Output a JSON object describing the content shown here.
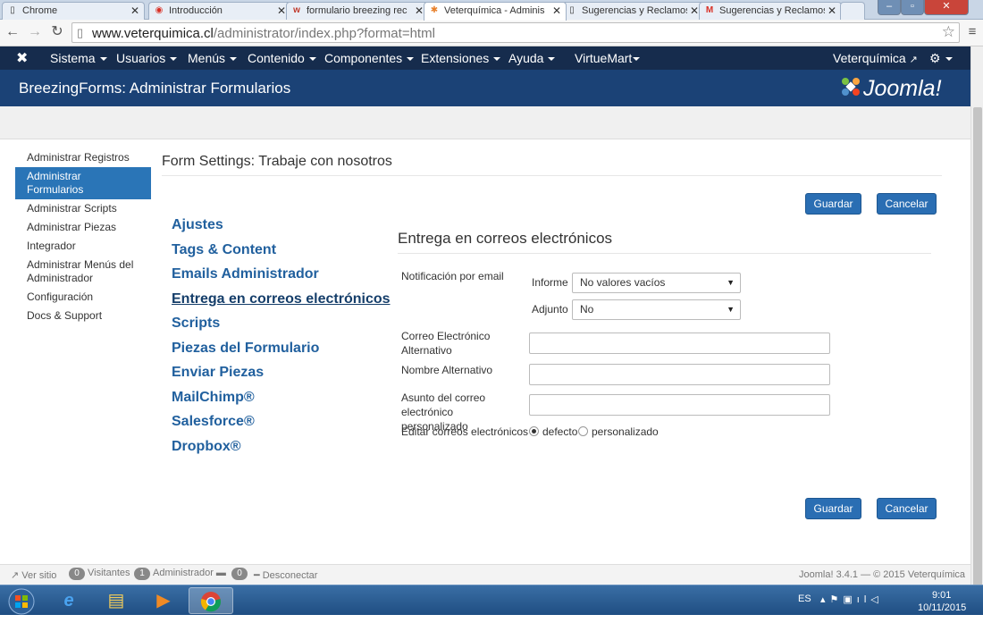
{
  "browser": {
    "tabs": [
      {
        "label": "Chrome",
        "icon": "page-icon",
        "active": false
      },
      {
        "label": "Introducción",
        "icon": "chrome-icon",
        "active": false
      },
      {
        "label": "formulario breezing rec",
        "icon": "w-icon",
        "active": false
      },
      {
        "label": "Veterquímica - Adminis",
        "icon": "joomla-icon",
        "active": true
      },
      {
        "label": "Sugerencias y Reclamos",
        "icon": "page-icon",
        "active": false
      },
      {
        "label": "Sugerencias y Reclamos",
        "icon": "gmail-icon",
        "active": false
      }
    ],
    "url_host": "www.veterquimica.cl",
    "url_path": "/administrator/index.php?format=html"
  },
  "joomla_nav": {
    "items": [
      {
        "label": "Sistema",
        "has_caret": true
      },
      {
        "label": "Usuarios",
        "has_caret": true
      },
      {
        "label": "Menús",
        "has_caret": true
      },
      {
        "label": "Contenido",
        "has_caret": true
      },
      {
        "label": "Componentes",
        "has_caret": true
      },
      {
        "label": "Extensiones",
        "has_caret": true
      },
      {
        "label": "Ayuda",
        "has_caret": true
      },
      {
        "label": "VirtueMart",
        "has_caret": true
      }
    ],
    "site_link": "Veterquímica"
  },
  "header": {
    "title": "BreezingForms: Administrar Formularios",
    "brand": "Joomla!"
  },
  "sidebar": {
    "items": [
      {
        "label": "Administrar Registros",
        "active": false
      },
      {
        "label": "Administrar Formularios",
        "active": true
      },
      {
        "label": "Administrar Scripts",
        "active": false
      },
      {
        "label": "Administrar Piezas",
        "active": false
      },
      {
        "label": "Integrador",
        "active": false
      },
      {
        "label": "Administrar Menús del Administrador",
        "active": false
      },
      {
        "label": "Configuración",
        "active": false
      },
      {
        "label": "Docs & Support",
        "active": false
      }
    ]
  },
  "main": {
    "form_title": "Form Settings: Trabaje con nosotros",
    "save_label": "Guardar",
    "cancel_label": "Cancelar",
    "settings_nav": [
      {
        "label": "Ajustes",
        "active": false
      },
      {
        "label": "Tags & Content",
        "active": false
      },
      {
        "label": "Emails Administrador",
        "active": false
      },
      {
        "label": "Entrega en correos electrónicos",
        "active": true
      },
      {
        "label": "Scripts",
        "active": false
      },
      {
        "label": "Piezas del Formulario",
        "active": false
      },
      {
        "label": "Enviar Piezas",
        "active": false
      },
      {
        "label": "MailChimp®",
        "active": false
      },
      {
        "label": "Salesforce®",
        "active": false
      },
      {
        "label": "Dropbox®",
        "active": false
      }
    ],
    "section_title": "Entrega en correos electrónicos",
    "fields": {
      "notification_label": "Notificación por email",
      "report_label": "Informe",
      "report_value": "No valores vacíos",
      "attach_label": "Adjunto",
      "attach_value": "No",
      "alt_email_label": "Correo Electrónico Alternativo",
      "alt_email_value": "",
      "alt_name_label": "Nombre Alternativo",
      "alt_name_value": "",
      "subject_label": "Asunto del correo electrónico personalizado",
      "subject_value": "",
      "edit_label": "Editar correos electrónicos",
      "edit_options": [
        "defecto",
        "personalizado"
      ],
      "edit_selected": "defecto"
    }
  },
  "statusbar": {
    "view_site": "Ver sitio",
    "visitors_count": "0",
    "visitors_label": "Visitantes",
    "admin_count": "1",
    "admin_label": "Administrador",
    "msg_count": "0",
    "logout": "Desconectar",
    "version": "Joomla! 3.4.1 — © 2015 Veterquímica"
  },
  "taskbar": {
    "lang": "ES",
    "time": "9:01",
    "date": "10/11/2015"
  },
  "colors": {
    "nav_bg": "#162c4d",
    "title_bg": "#1b4276",
    "accent": "#2a6eb3",
    "link": "#21609e"
  }
}
